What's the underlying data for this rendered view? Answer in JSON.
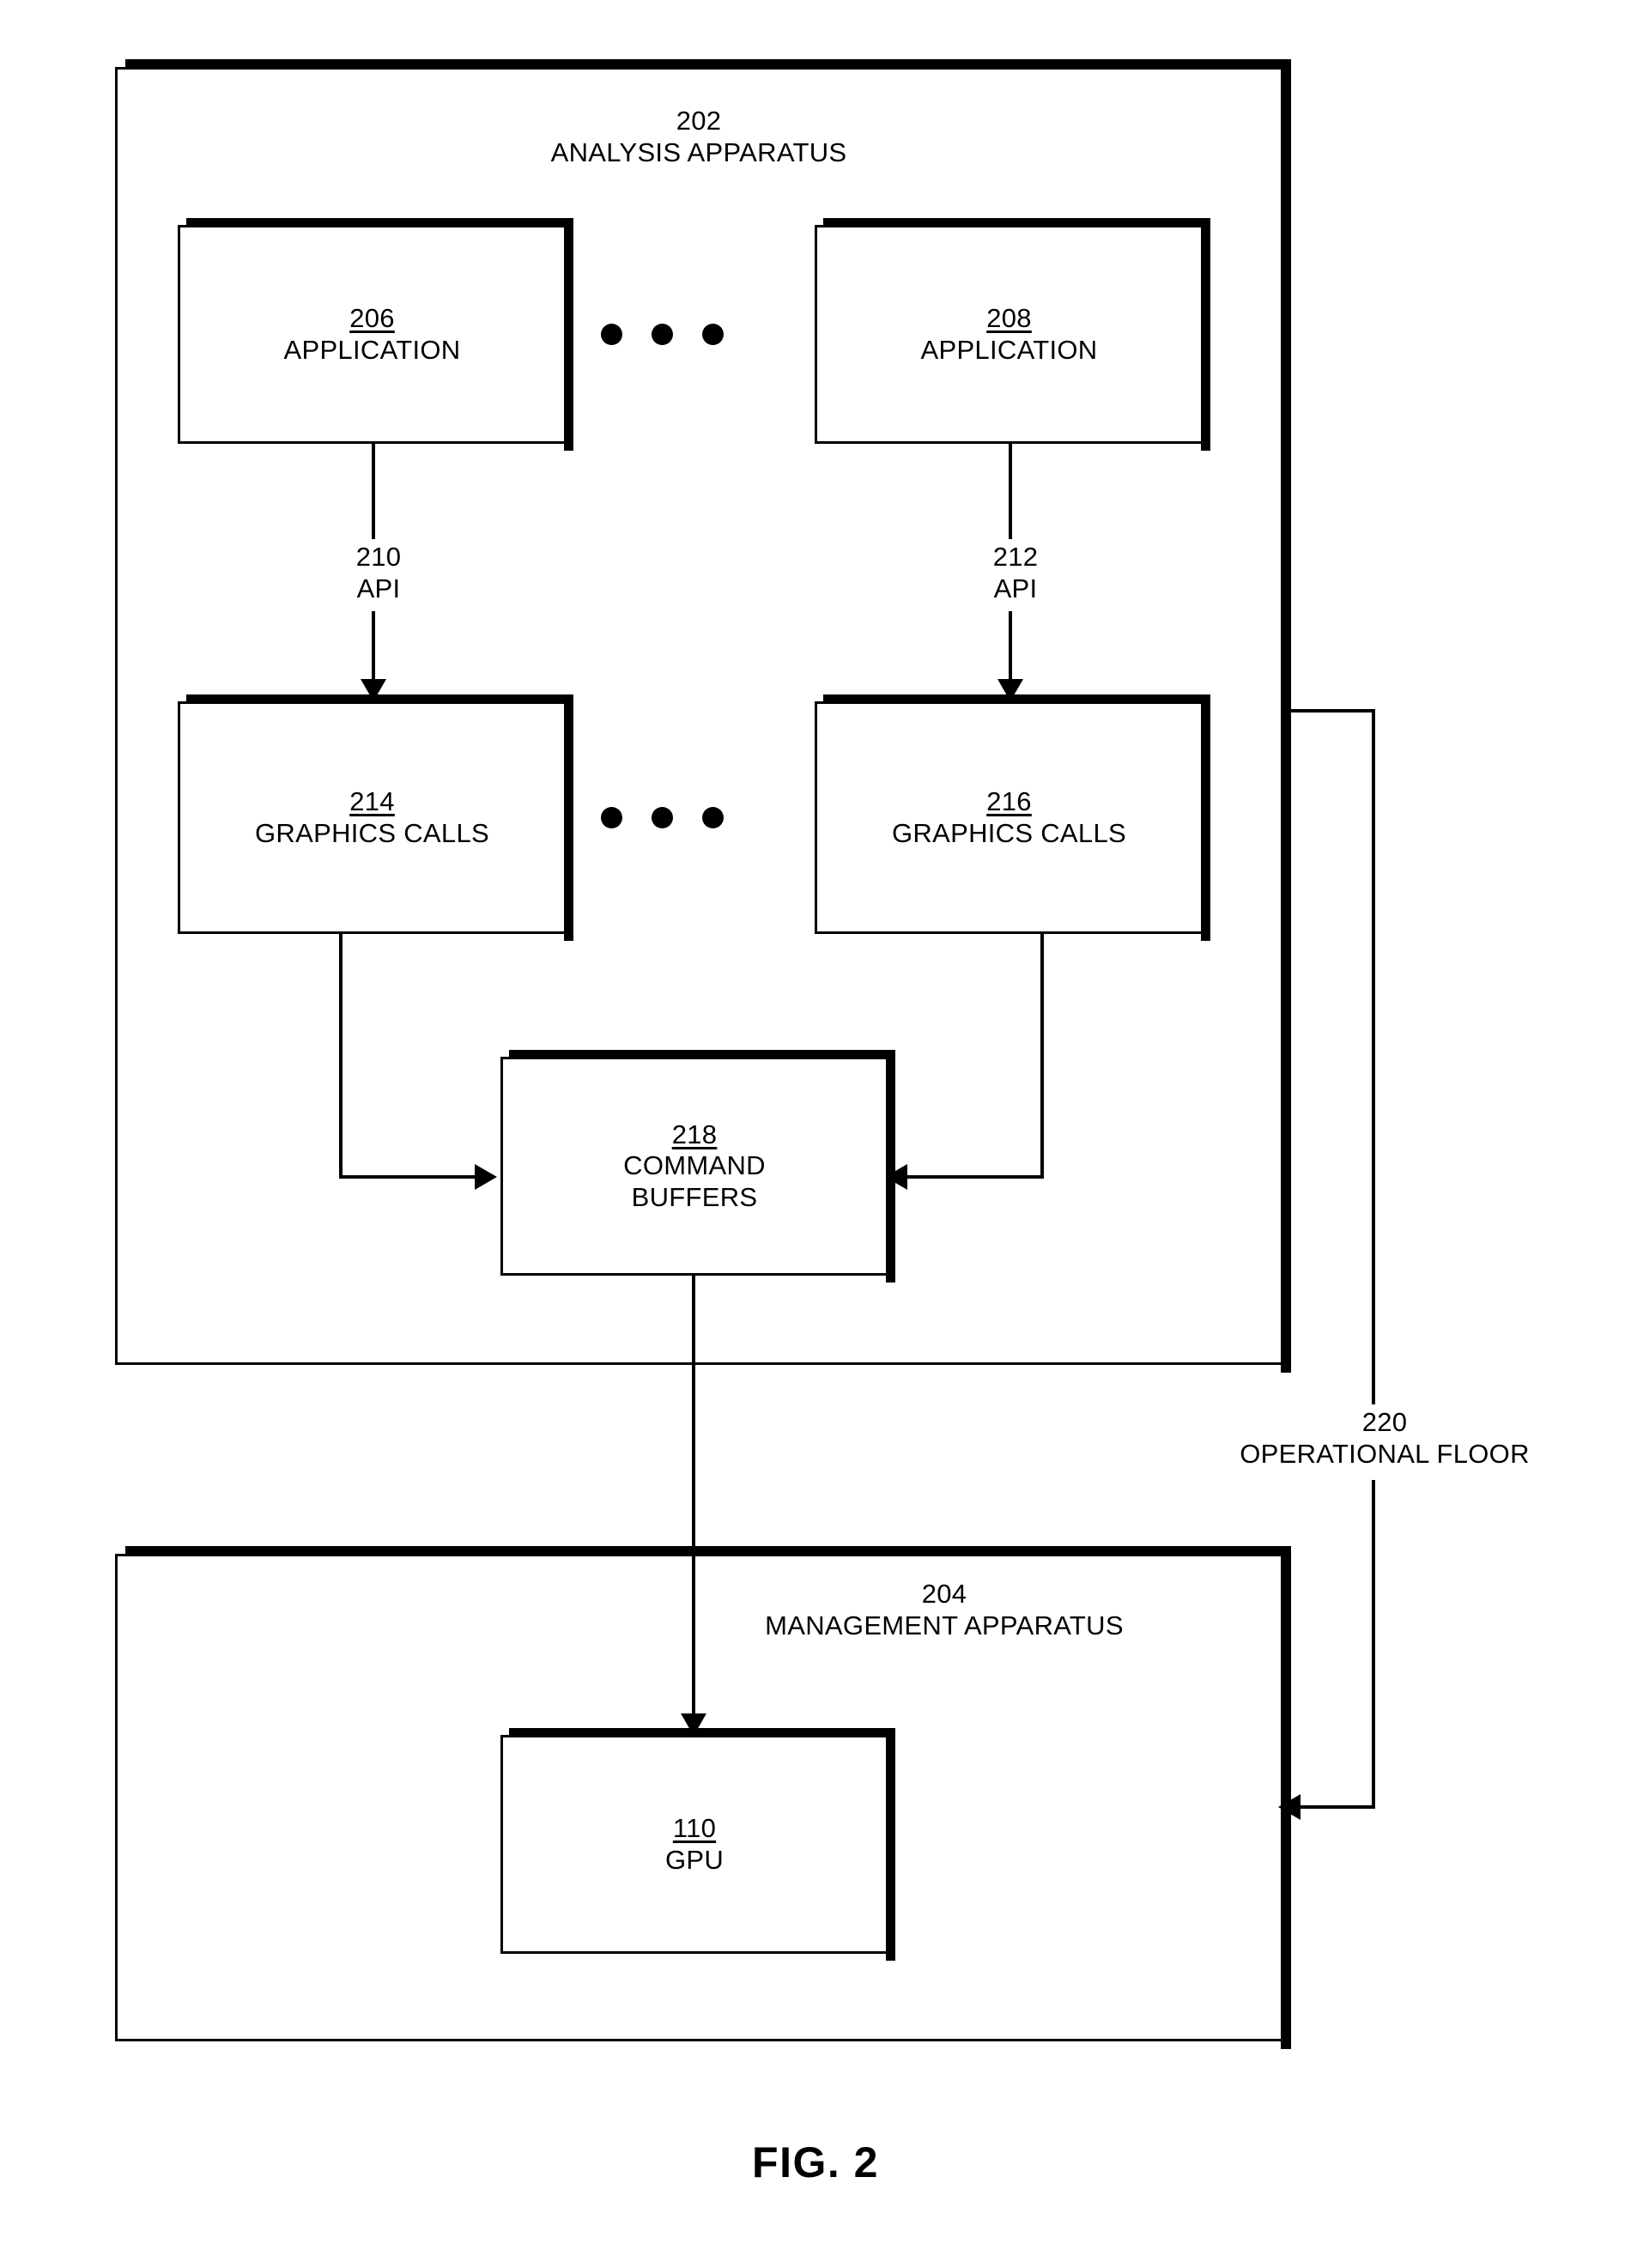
{
  "figure": {
    "caption": "FIG. 2"
  },
  "containers": {
    "analysis": {
      "ref": "202",
      "label": "ANALYSIS APPARATUS"
    },
    "management": {
      "ref": "204",
      "label": "MANAGEMENT APPARATUS"
    }
  },
  "nodes": {
    "application_left": {
      "ref": "206",
      "label": "APPLICATION"
    },
    "application_right": {
      "ref": "208",
      "label": "APPLICATION"
    },
    "graphics_calls_left": {
      "ref": "214",
      "label": "GRAPHICS CALLS"
    },
    "graphics_calls_right": {
      "ref": "216",
      "label": "GRAPHICS CALLS"
    },
    "command_buffers": {
      "ref": "218",
      "label": "COMMAND\nBUFFERS"
    },
    "gpu": {
      "ref": "110",
      "label": "GPU"
    }
  },
  "edges": {
    "api_left": {
      "ref": "210",
      "label": "API"
    },
    "api_right": {
      "ref": "212",
      "label": "API"
    },
    "operational_floor": {
      "ref": "220",
      "label": "OPERATIONAL FLOOR"
    }
  },
  "ellipsis": {
    "top_row": "• • •",
    "middle_row": "• • •"
  },
  "colors": {
    "stroke": "#000000",
    "background": "#ffffff"
  }
}
